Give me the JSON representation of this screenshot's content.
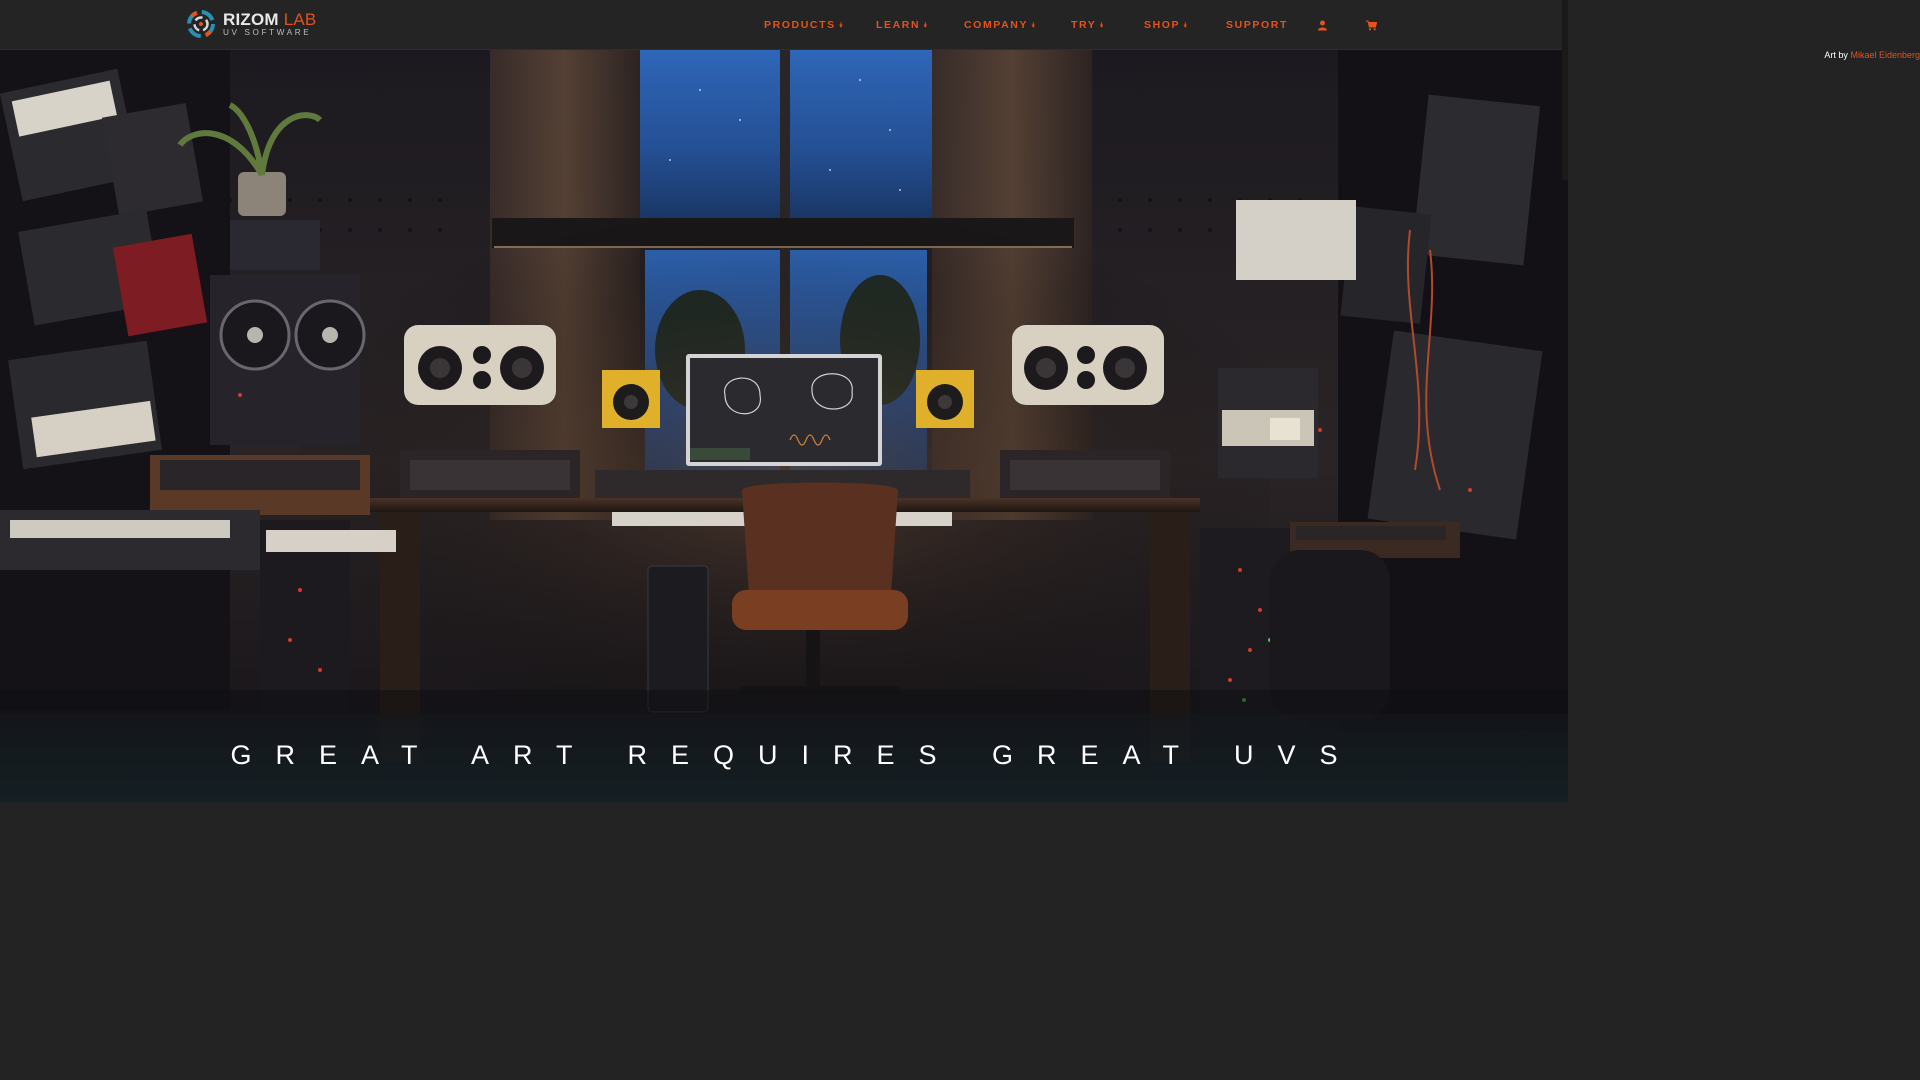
{
  "brand": {
    "name_primary": "RIZOM",
    "name_accent": "LAB",
    "subtitle": "UV SOFTWARE",
    "logo_icon": "rizom-logo-icon"
  },
  "nav": {
    "items": [
      {
        "label": "PRODUCTS",
        "icon": "chevron-down-icon"
      },
      {
        "label": "LEARN",
        "icon": "chevron-down-icon"
      },
      {
        "label": "COMPANY",
        "icon": "chevron-down-icon"
      },
      {
        "label": "TRY",
        "icon": "chevron-down-icon"
      },
      {
        "label": "SHOP",
        "icon": "chevron-down-icon"
      },
      {
        "label": "SUPPORT"
      }
    ],
    "user_icon": "user-icon",
    "cart_icon": "cart-icon"
  },
  "hero": {
    "credit_prefix": "Art by",
    "credit_artist": "Mikael Eidenberg",
    "tagline": "GREAT ART REQUIRES GREAT UVS",
    "image_subject": "music-studio-illustration"
  },
  "colors": {
    "accent": "#e2531f",
    "header_bg": "#242424",
    "tagline_text": "#ffffff"
  }
}
